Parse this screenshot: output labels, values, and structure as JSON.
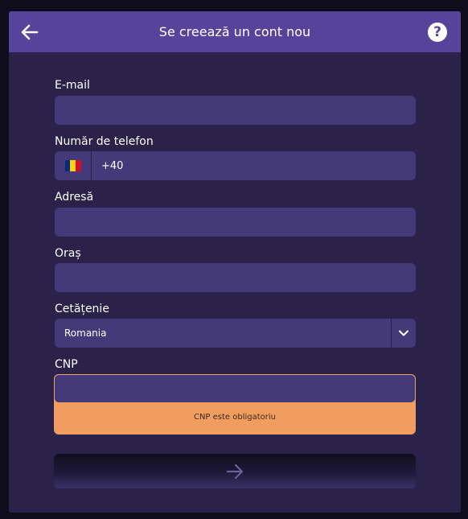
{
  "header": {
    "title": "Se creează un cont nou",
    "back_icon": "arrow-left-icon",
    "help_icon": "question-icon",
    "help_glyph": "?"
  },
  "form": {
    "email": {
      "label": "E-mail",
      "value": ""
    },
    "phone": {
      "label": "Număr de telefon",
      "country_flag": "romania-flag-icon",
      "value": "+40"
    },
    "address": {
      "label": "Adresă",
      "value": ""
    },
    "city": {
      "label": "Oraș",
      "value": ""
    },
    "citizenship": {
      "label": "Cetățenie",
      "selected": "Romania"
    },
    "cnp": {
      "label": "CNP",
      "value": "",
      "error": "CNP este obligatoriu"
    }
  },
  "submit": {
    "icon": "arrow-right-icon"
  },
  "colors": {
    "background": "#0f0c1c",
    "panel": "#2a2249",
    "header": "#56449a",
    "field": "#443a7a",
    "error": "#f09d5f",
    "flag": [
      "#002b7f",
      "#fcd116",
      "#ce1126"
    ]
  }
}
